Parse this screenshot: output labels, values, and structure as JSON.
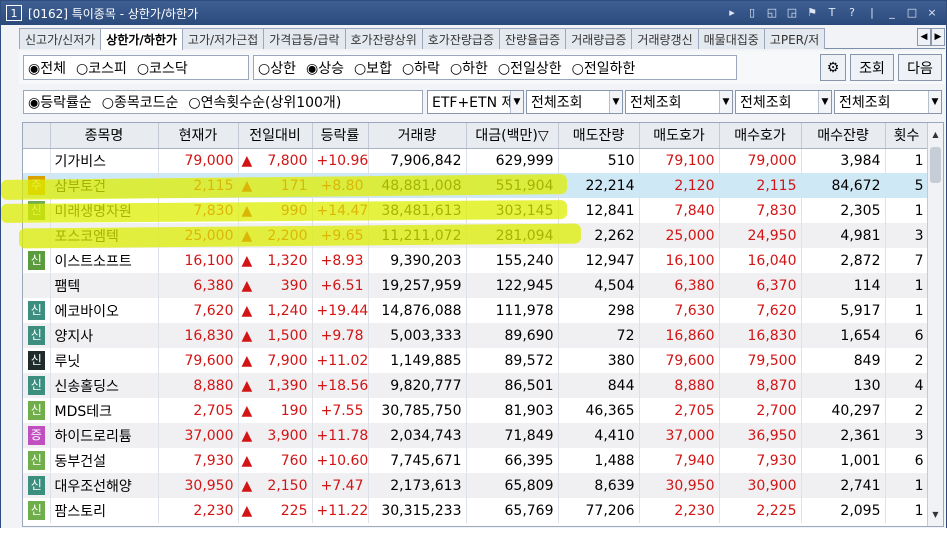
{
  "window": {
    "number": "1",
    "title": "[0162] 특이종목 - 상한가/하한가"
  },
  "title_tools": [
    "▸",
    "▯",
    "◱",
    "◲",
    "⚑",
    "T",
    "?",
    "|",
    "_",
    "□",
    "×"
  ],
  "tabs": [
    "신고가/신저가",
    "상한가/하한가",
    "고가/저가근접",
    "가격급등/급락",
    "호가잔량상위",
    "호가잔량급증",
    "잔량율급증",
    "거래량급증",
    "거래량갱신",
    "매물대집중",
    "고PER/저"
  ],
  "market_filter": [
    "◉전체",
    "○코스피",
    "○코스닥"
  ],
  "price_filter": [
    "○상한",
    "◉상승",
    "○보합",
    "○하락",
    "○하한",
    "○전일상한",
    "○전일하한"
  ],
  "buttons": {
    "tool_icon": "⚙",
    "query": "조회",
    "next": "다음"
  },
  "sort_filter": [
    "◉등락률순",
    "○종목코드순",
    "○연속횟수순(상위100개)"
  ],
  "selects": [
    "ETF+ETN 제",
    "전체조회",
    "전체조회",
    "전체조회",
    "전체조회"
  ],
  "columns": [
    "",
    "종목명",
    "현재가",
    "전일대비",
    "등락률",
    "거래량",
    "대금(백만)▽",
    "매도잔량",
    "매도호가",
    "매수호가",
    "매수잔량",
    "횟수"
  ],
  "rows": [
    {
      "badge": "",
      "badge_type": "",
      "name": "기가비스",
      "price": "79,000",
      "tri": "▲",
      "change": "7,800",
      "rate": "+10.96",
      "volume": "7,906,842",
      "amount": "629,999",
      "ask_qty": "510",
      "ask": "79,100",
      "bid": "79,000",
      "bid_qty": "3,984",
      "count": "1"
    },
    {
      "badge": "주",
      "badge_type": "ju",
      "name": "삼부토건",
      "price": "2,115",
      "tri": "▲",
      "change": "171",
      "rate": "+8.80",
      "volume": "48,881,008",
      "amount": "551,904",
      "ask_qty": "22,214",
      "ask": "2,120",
      "bid": "2,115",
      "bid_qty": "84,672",
      "count": "5"
    },
    {
      "badge": "신",
      "badge_type": "sinl",
      "name": "미래생명자원",
      "price": "7,830",
      "tri": "▲",
      "change": "990",
      "rate": "+14.47",
      "volume": "38,481,613",
      "amount": "303,145",
      "ask_qty": "12,841",
      "ask": "7,840",
      "bid": "7,830",
      "bid_qty": "2,305",
      "count": "1"
    },
    {
      "badge": "",
      "badge_type": "",
      "name": "포스코엠텍",
      "price": "25,000",
      "tri": "▲",
      "change": "2,200",
      "rate": "+9.65",
      "volume": "11,211,072",
      "amount": "281,094",
      "ask_qty": "2,262",
      "ask": "25,000",
      "bid": "24,950",
      "bid_qty": "4,981",
      "count": "3"
    },
    {
      "badge": "신",
      "badge_type": "sin",
      "name": "이스트소프트",
      "price": "16,100",
      "tri": "▲",
      "change": "1,320",
      "rate": "+8.93",
      "volume": "9,390,203",
      "amount": "155,240",
      "ask_qty": "12,947",
      "ask": "16,100",
      "bid": "16,040",
      "bid_qty": "2,872",
      "count": "7"
    },
    {
      "badge": "",
      "badge_type": "",
      "name": "팸텍",
      "price": "6,380",
      "tri": "▲",
      "change": "390",
      "rate": "+6.51",
      "volume": "19,257,959",
      "amount": "122,945",
      "ask_qty": "4,504",
      "ask": "6,380",
      "bid": "6,370",
      "bid_qty": "114",
      "count": "1"
    },
    {
      "badge": "신",
      "badge_type": "sint",
      "name": "에코바이오",
      "price": "7,620",
      "tri": "▲",
      "change": "1,240",
      "rate": "+19.44",
      "volume": "14,876,088",
      "amount": "111,978",
      "ask_qty": "298",
      "ask": "7,630",
      "bid": "7,620",
      "bid_qty": "5,917",
      "count": "1"
    },
    {
      "badge": "신",
      "badge_type": "sint",
      "name": "양지사",
      "price": "16,830",
      "tri": "▲",
      "change": "1,500",
      "rate": "+9.78",
      "volume": "5,003,333",
      "amount": "89,690",
      "ask_qty": "72",
      "ask": "16,860",
      "bid": "16,830",
      "bid_qty": "1,654",
      "count": "6"
    },
    {
      "badge": "신",
      "badge_type": "sinb",
      "name": "루닛",
      "price": "79,600",
      "tri": "▲",
      "change": "7,900",
      "rate": "+11.02",
      "volume": "1,149,885",
      "amount": "89,572",
      "ask_qty": "380",
      "ask": "79,600",
      "bid": "79,500",
      "bid_qty": "849",
      "count": "2"
    },
    {
      "badge": "신",
      "badge_type": "sint",
      "name": "신송홀딩스",
      "price": "8,880",
      "tri": "▲",
      "change": "1,390",
      "rate": "+18.56",
      "volume": "9,820,777",
      "amount": "86,501",
      "ask_qty": "844",
      "ask": "8,880",
      "bid": "8,870",
      "bid_qty": "130",
      "count": "4"
    },
    {
      "badge": "신",
      "badge_type": "sinl",
      "name": "MDS테크",
      "price": "2,705",
      "tri": "▲",
      "change": "190",
      "rate": "+7.55",
      "volume": "30,785,750",
      "amount": "81,903",
      "ask_qty": "46,365",
      "ask": "2,705",
      "bid": "2,700",
      "bid_qty": "40,297",
      "count": "2"
    },
    {
      "badge": "증",
      "badge_type": "jeung",
      "name": "하이드로리튬",
      "price": "37,000",
      "tri": "▲",
      "change": "3,900",
      "rate": "+11.78",
      "volume": "2,034,743",
      "amount": "71,849",
      "ask_qty": "4,410",
      "ask": "37,000",
      "bid": "36,950",
      "bid_qty": "2,361",
      "count": "3"
    },
    {
      "badge": "신",
      "badge_type": "sinl",
      "name": "동부건설",
      "price": "7,930",
      "tri": "▲",
      "change": "760",
      "rate": "+10.60",
      "volume": "7,745,671",
      "amount": "66,395",
      "ask_qty": "1,488",
      "ask": "7,940",
      "bid": "7,930",
      "bid_qty": "1,001",
      "count": "6"
    },
    {
      "badge": "신",
      "badge_type": "sint",
      "name": "대우조선해양",
      "price": "30,950",
      "tri": "▲",
      "change": "2,150",
      "rate": "+7.47",
      "volume": "2,173,613",
      "amount": "65,809",
      "ask_qty": "8,639",
      "ask": "30,950",
      "bid": "30,900",
      "bid_qty": "2,741",
      "count": "1"
    },
    {
      "badge": "신",
      "badge_type": "sinl",
      "name": "팜스토리",
      "price": "2,230",
      "tri": "▲",
      "change": "225",
      "rate": "+11.22",
      "volume": "30,315,233",
      "amount": "65,769",
      "ask_qty": "77,206",
      "ask": "2,230",
      "bid": "2,225",
      "bid_qty": "2,095",
      "count": "1"
    }
  ],
  "colors": {
    "up": "#d21414",
    "highlight": "#dcec00",
    "selected_row": "#cfe8f5",
    "title_bar": "#2b4a7c"
  }
}
